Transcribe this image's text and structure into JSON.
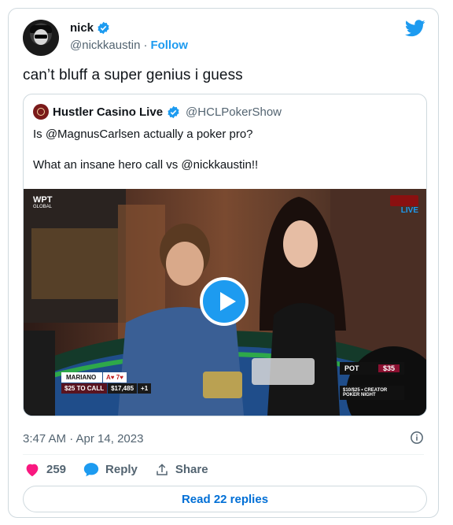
{
  "author": {
    "display_name": "nick",
    "handle": "@nickkaustin",
    "separator": "·",
    "follow_label": "Follow"
  },
  "tweet_text": "can’t bluff a super genius i guess",
  "quote": {
    "display_name": "Hustler Casino Live",
    "handle": "@HCLPokerShow",
    "line1": "Is @MagnusCarlsen actually a poker pro?",
    "line2": "What an insane hero call vs @nickkaustin!!"
  },
  "video": {
    "brand_left": "WPT",
    "brand_left_sub": "GLOBAL",
    "brand_right_sub": "LIVE",
    "player_name": "MARIANO",
    "player_cards": "A♥ 7♥",
    "to_call": "$25 TO CALL",
    "stack": "$17,485",
    "stack_delta": "+1",
    "pot_label": "POT",
    "pot_amount": "$35",
    "stakes_text": "$10/$25 • CREATOR POKER NIGHT"
  },
  "timestamp": "3:47 AM · Apr 14, 2023",
  "actions": {
    "like_count": "259",
    "reply_label": "Reply",
    "share_label": "Share"
  },
  "read_replies": "Read 22 replies",
  "colors": {
    "accent": "#1d9bf0",
    "like": "#f91880",
    "text": "#0f1419",
    "muted": "#536471"
  }
}
